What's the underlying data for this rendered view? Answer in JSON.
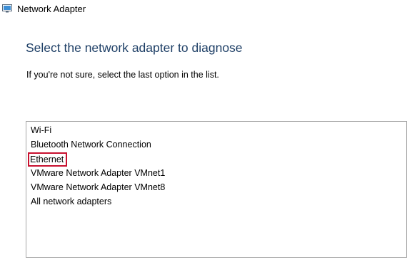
{
  "window": {
    "title": "Network Adapter",
    "icon": "network-adapter-icon"
  },
  "heading": "Select the network adapter to diagnose",
  "hint": "If you're not sure, select the last option in the list.",
  "adapters": {
    "items": [
      "Wi-Fi",
      "Bluetooth Network Connection",
      "Ethernet",
      "VMware Network Adapter VMnet1",
      "VMware Network Adapter VMnet8",
      "All network adapters"
    ],
    "highlighted": "Ethernet"
  },
  "colors": {
    "heading": "#1e3f66",
    "highlight_border": "#c8102e",
    "list_border": "#a6a6a6"
  }
}
